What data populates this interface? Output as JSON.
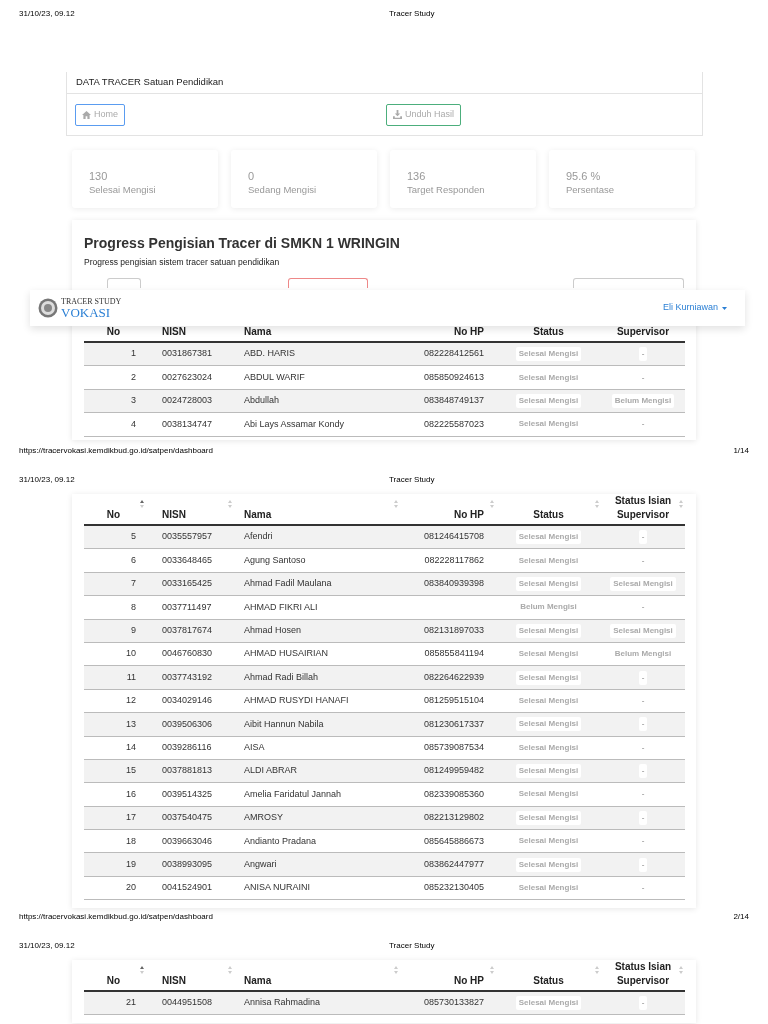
{
  "print_pages": [
    {
      "date": "31/10/23, 09.12",
      "title": "Tracer Study",
      "url": "https://tracervokasi.kemdikbud.go.id/satpen/dashboard",
      "page_number": "1/14"
    },
    {
      "date": "31/10/23, 09.12",
      "title": "Tracer Study",
      "url": "https://tracervokasi.kemdikbud.go.id/satpen/dashboard",
      "page_number": "2/14"
    },
    {
      "date": "31/10/23, 09.12",
      "title": "Tracer Study"
    }
  ],
  "navbar": {
    "logo_small": "TRACER STUDY",
    "logo_large": "VOKASI",
    "user": "Eli Kurniawan"
  },
  "top_card": {
    "title": "DATA TRACER Satuan Pendidikan",
    "buttons": [
      {
        "label": "Home",
        "kind": "home"
      },
      {
        "label": "Unduh Hasil",
        "kind": "download"
      }
    ]
  },
  "stats": [
    {
      "value": "130",
      "label": "Selesai Mengisi"
    },
    {
      "value": "0",
      "label": "Sedang Mengisi"
    },
    {
      "value": "136",
      "label": "Target Responden"
    },
    {
      "value": "95.6 %",
      "label": "Persentase"
    }
  ],
  "progress": {
    "title": "Progress Pengisian Tracer di SMKN 1 WRINGIN",
    "subtitle": "Progress pengisian sistem tracer satuan pendidikan"
  },
  "table_pages": [
    {
      "columns": [
        {
          "label": "No"
        },
        {
          "label": "NISN"
        },
        {
          "label": "Nama"
        },
        {
          "label": "No HP"
        },
        {
          "label": "Status"
        },
        {
          "label": "Supervisor"
        }
      ],
      "rows": [
        {
          "no": "1",
          "nisn": "0031867381",
          "nama": "ABD. HARIS",
          "no_hp": "082228412561",
          "status": "Selesai Mengisi",
          "supervisor": "-"
        },
        {
          "no": "2",
          "nisn": "0027623024",
          "nama": "ABDUL WARIF",
          "no_hp": "085850924613",
          "status": "Selesai Mengisi",
          "supervisor": "-"
        },
        {
          "no": "3",
          "nisn": "0024728003",
          "nama": "Abdullah",
          "no_hp": "083848749137",
          "status": "Selesai Mengisi",
          "supervisor": "Belum Mengisi"
        },
        {
          "no": "4",
          "nisn": "0038134747",
          "nama": "Abi Lays Assamar Kondy",
          "no_hp": "082225587023",
          "status": "Selesai Mengisi",
          "supervisor": "-"
        }
      ]
    },
    {
      "columns": [
        {
          "label": "No",
          "sorted": true
        },
        {
          "label": "NISN",
          "sorted": false
        },
        {
          "label": "Nama",
          "sorted": false
        },
        {
          "label": "No HP",
          "sorted": false
        },
        {
          "label": "Status",
          "sorted": false
        },
        {
          "label": "Status Isian Supervisor",
          "sorted": false
        }
      ],
      "rows": [
        {
          "no": "5",
          "nisn": "0035557957",
          "nama": "Afendri",
          "no_hp": "081246415708",
          "status": "Selesai Mengisi",
          "supervisor": "-"
        },
        {
          "no": "6",
          "nisn": "0033648465",
          "nama": "Agung Santoso",
          "no_hp": "082228117862",
          "status": "Selesai Mengisi",
          "supervisor": "-"
        },
        {
          "no": "7",
          "nisn": "0033165425",
          "nama": "Ahmad Fadil Maulana",
          "no_hp": "083840939398",
          "status": "Selesai Mengisi",
          "supervisor": "Selesai Mengisi"
        },
        {
          "no": "8",
          "nisn": "0037711497",
          "nama": "AHMAD FIKRI ALI",
          "status": "Belum Mengisi",
          "supervisor": "-"
        },
        {
          "no": "9",
          "nisn": "0037817674",
          "nama": "Ahmad Hosen",
          "no_hp": "082131897033",
          "status": "Selesai Mengisi",
          "supervisor": "Selesai Mengisi"
        },
        {
          "no": "10",
          "nisn": "0046760830",
          "nama": "AHMAD HUSAIRIAN",
          "no_hp": "085855841194",
          "status": "Selesai Mengisi",
          "supervisor": "Belum Mengisi"
        },
        {
          "no": "11",
          "nisn": "0037743192",
          "nama": "Ahmad Radi Billah",
          "no_hp": "082264622939",
          "status": "Selesai Mengisi",
          "supervisor": "-"
        },
        {
          "no": "12",
          "nisn": "0034029146",
          "nama": "AHMAD RUSYDI HANAFI",
          "no_hp": "081259515104",
          "status": "Selesai Mengisi",
          "supervisor": "-"
        },
        {
          "no": "13",
          "nisn": "0039506306",
          "nama": "Aibit Hannun Nabila",
          "no_hp": "081230617337",
          "status": "Selesai Mengisi",
          "supervisor": "-"
        },
        {
          "no": "14",
          "nisn": "0039286116",
          "nama": "AISA",
          "no_hp": "085739087534",
          "status": "Selesai Mengisi",
          "supervisor": "-"
        },
        {
          "no": "15",
          "nisn": "0037881813",
          "nama": "ALDI ABRAR",
          "no_hp": "081249959482",
          "status": "Selesai Mengisi",
          "supervisor": "-"
        },
        {
          "no": "16",
          "nisn": "0039514325",
          "nama": "Amelia Faridatul Jannah",
          "no_hp": "082339085360",
          "status": "Selesai Mengisi",
          "supervisor": "-"
        },
        {
          "no": "17",
          "nisn": "0037540475",
          "nama": "AMROSY",
          "no_hp": "082213129802",
          "status": "Selesai Mengisi",
          "supervisor": "-"
        },
        {
          "no": "18",
          "nisn": "0039663046",
          "nama": "Andianto Pradana",
          "no_hp": "085645886673",
          "status": "Selesai Mengisi",
          "supervisor": "-"
        },
        {
          "no": "19",
          "nisn": "0038993095",
          "nama": "Angwari",
          "no_hp": "083862447977",
          "status": "Selesai Mengisi",
          "supervisor": "-"
        },
        {
          "no": "20",
          "nisn": "0041524901",
          "nama": "ANISA NURAINI",
          "no_hp": "085232130405",
          "status": "Selesai Mengisi",
          "supervisor": "-"
        }
      ]
    },
    {
      "columns": [
        {
          "label": "No",
          "sorted": true
        },
        {
          "label": "NISN",
          "sorted": false
        },
        {
          "label": "Nama",
          "sorted": false
        },
        {
          "label": "No HP",
          "sorted": false
        },
        {
          "label": "Status",
          "sorted": false
        },
        {
          "label": "Status Isian Supervisor",
          "sorted": false
        }
      ],
      "rows": [
        {
          "no": "21",
          "nisn": "0044951508",
          "nama": "Annisa Rahmadina",
          "no_hp": "085730133827",
          "status": "Selesai Mengisi",
          "supervisor": "-"
        }
      ]
    }
  ]
}
